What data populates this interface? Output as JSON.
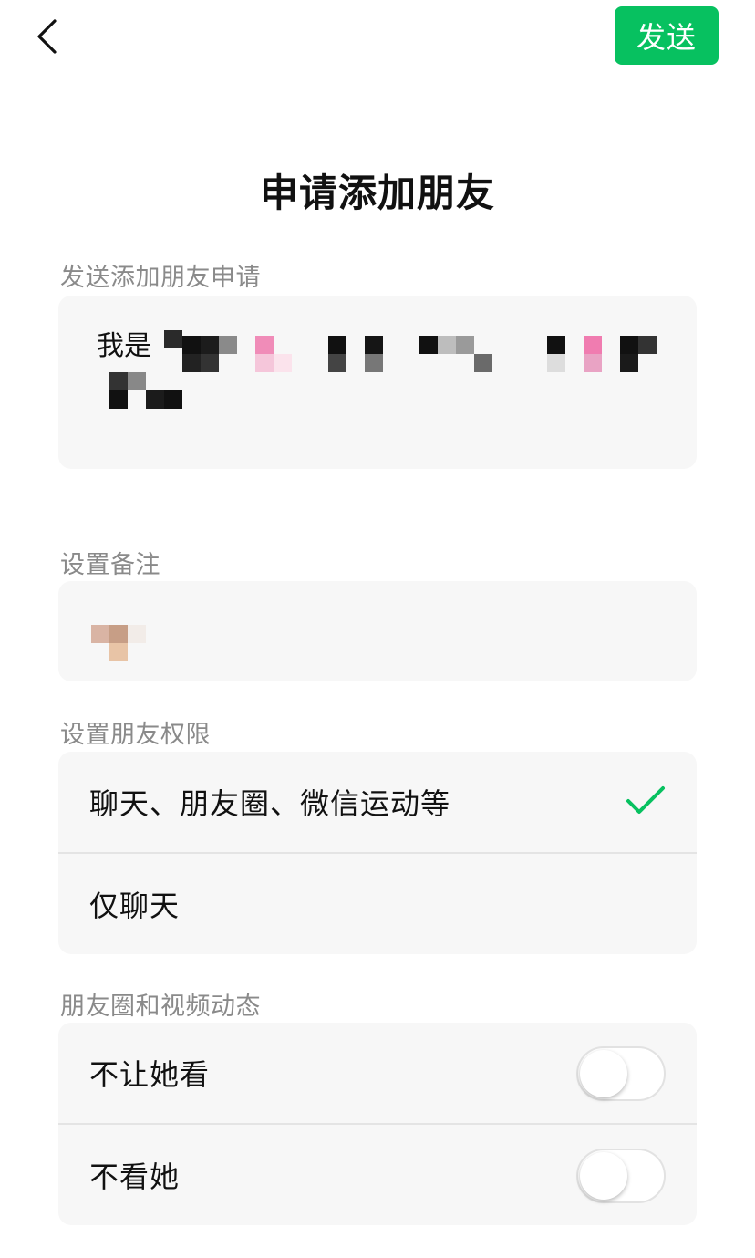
{
  "header": {
    "back_icon": "chevron-left-icon",
    "send_label": "发送"
  },
  "page_title": "申请添加朋友",
  "request_section": {
    "label": "发送添加朋友申请",
    "message": "我是"
  },
  "remark_section": {
    "label": "设置备注",
    "value": ""
  },
  "permission_section": {
    "label": "设置朋友权限",
    "options": [
      {
        "label": "聊天、朋友圈、微信运动等",
        "selected": true
      },
      {
        "label": "仅聊天",
        "selected": false
      }
    ],
    "check_icon": "checkmark-icon"
  },
  "feed_section": {
    "label": "朋友圈和视频动态",
    "toggles": [
      {
        "label": "不让她看",
        "on": false
      },
      {
        "label": "不看她",
        "on": false
      }
    ]
  },
  "colors": {
    "accent": "#07c160",
    "card_bg": "#f7f7f7",
    "label_gray": "#8a8a8a",
    "divider": "#e4e4e4"
  }
}
